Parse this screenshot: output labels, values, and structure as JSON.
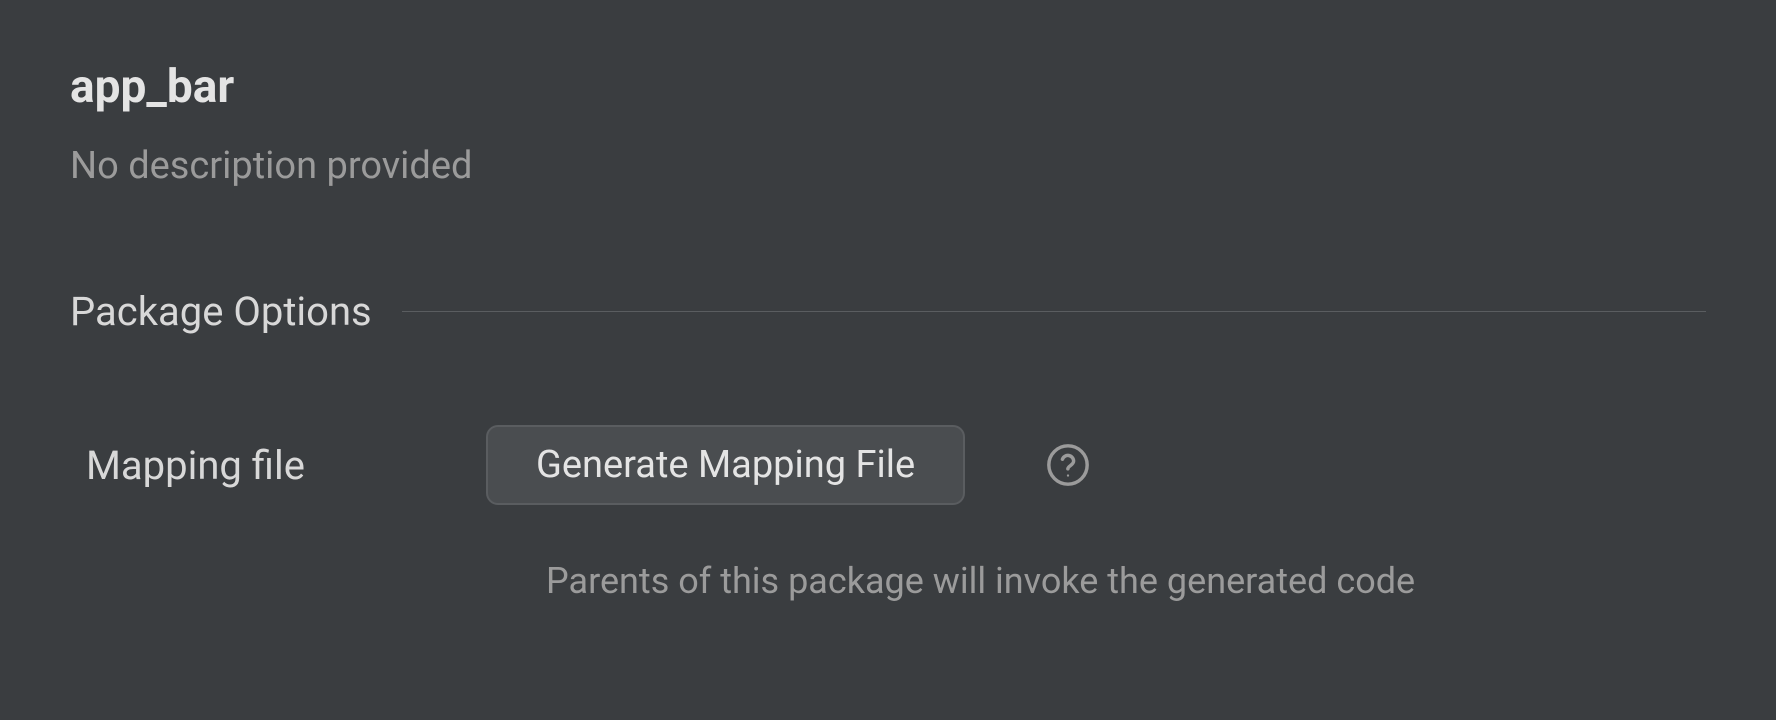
{
  "header": {
    "title": "app_bar",
    "description": "No description provided"
  },
  "section": {
    "title": "Package Options",
    "fields": {
      "mapping_file": {
        "label": "Mapping file",
        "button_label": "Generate Mapping File",
        "hint": "Parents of this package will invoke the generated code"
      }
    }
  }
}
